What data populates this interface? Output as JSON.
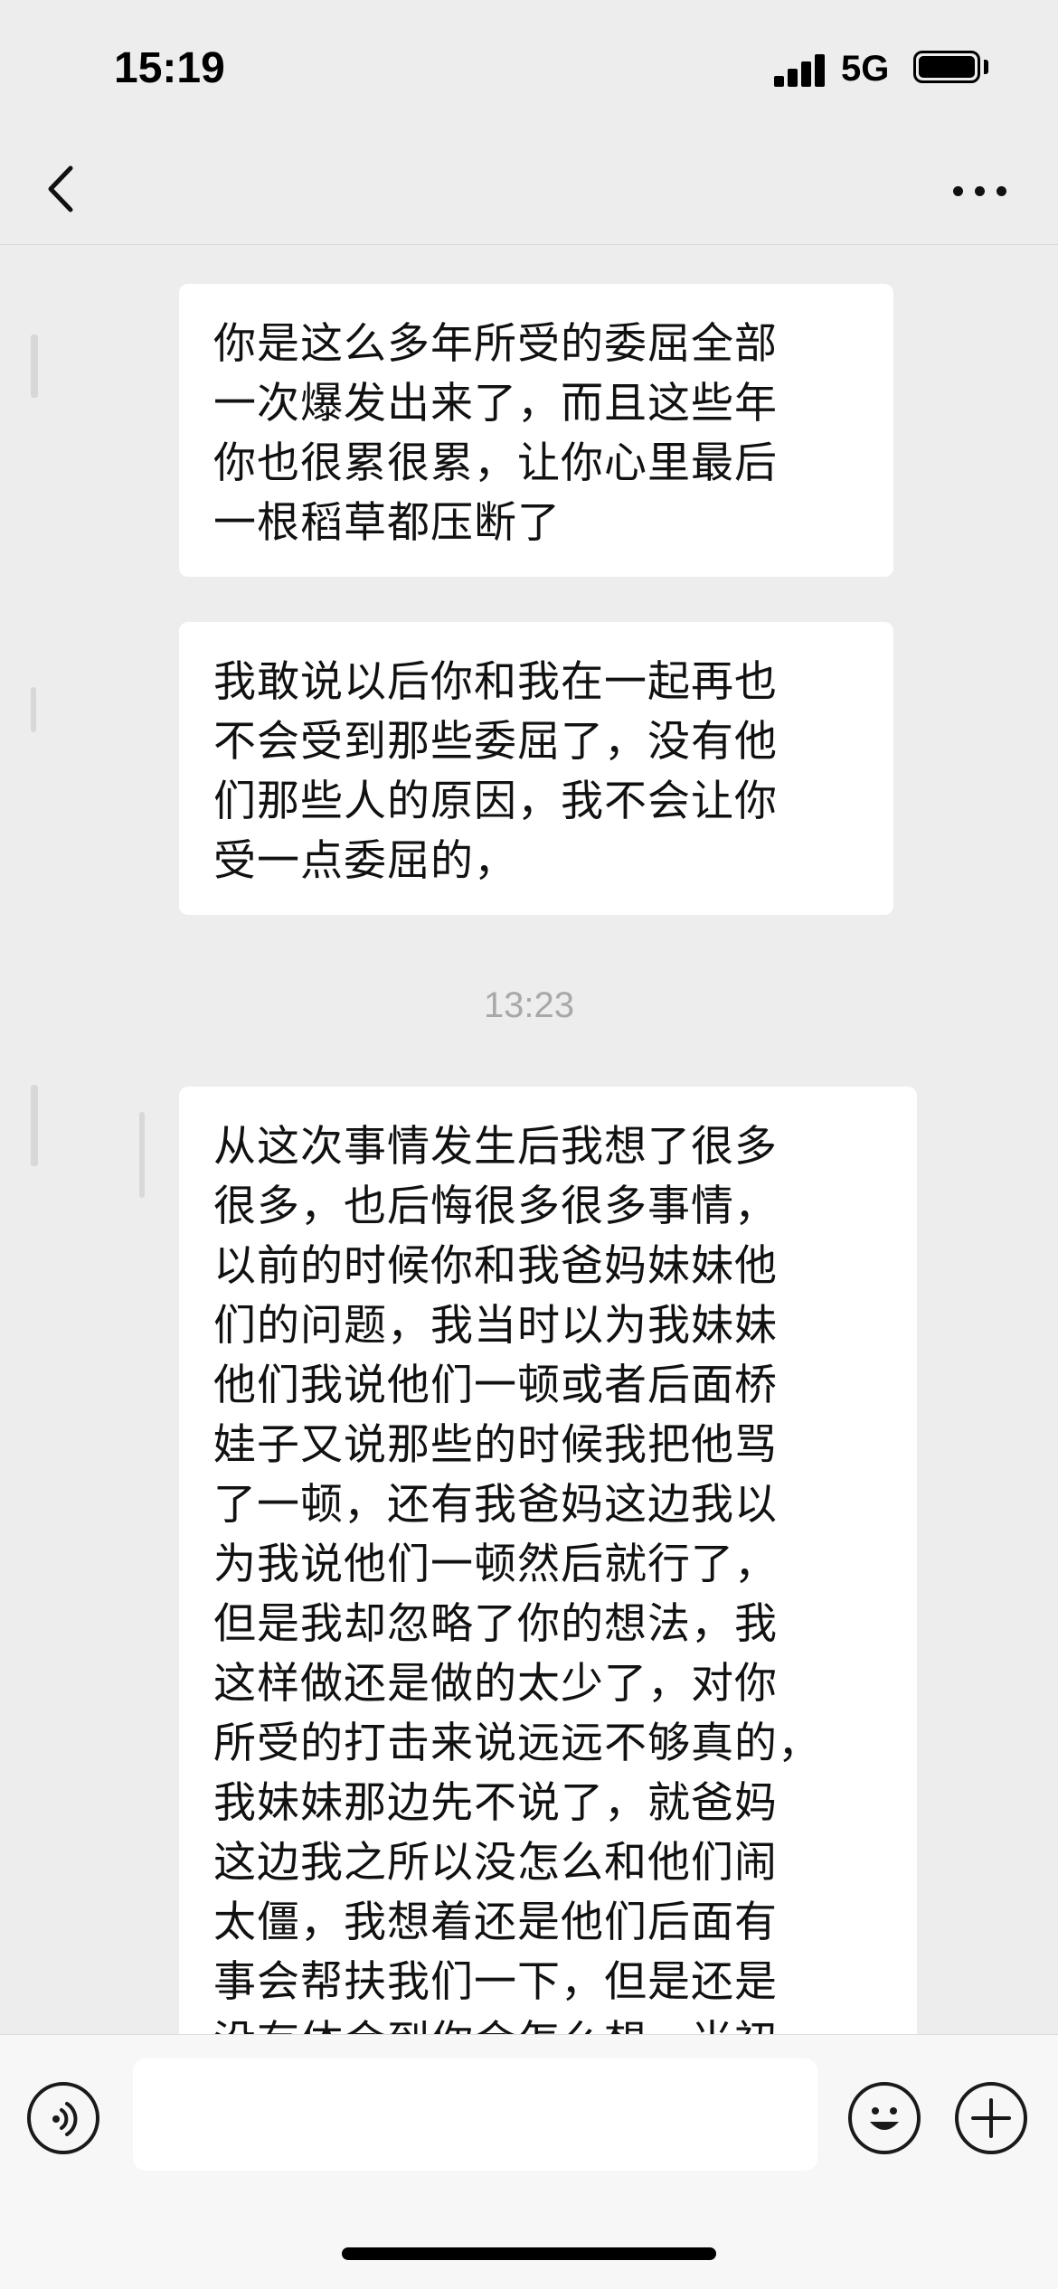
{
  "status_bar": {
    "time": "15:19",
    "network": "5G"
  },
  "nav": {
    "back_icon": "chevron-left-icon",
    "more_icon": "more-horizontal-icon"
  },
  "messages": [
    {
      "text": "你是这么多年所受的委屈全部\n一次爆发出来了，而且这些年\n你也很累很累，让你心里最后\n一根稻草都压断了"
    },
    {
      "text": "我敢说以后你和我在一起再也\n不会受到那些委屈了，没有他\n们那些人的原因，我不会让你\n受一点委屈的，"
    },
    {
      "text": "从这次事情发生后我想了很多\n很多，也后悔很多很多事情，\n以前的时候你和我爸妈妹妹他\n们的问题，我当时以为我妹妹\n他们我说他们一顿或者后面桥\n娃子又说那些的时候我把他骂\n了一顿，还有我爸妈这边我以\n为我说他们一顿然后就行了，\n但是我却忽略了你的想法，我\n这样做还是做的太少了，对你\n所受的打击来说远远不够真的，\n我妹妹那边先不说了，就爸妈\n这边我之所以没怎么和他们闹\n太僵，我想着还是他们后面有\n事会帮扶我们一下，但是还是\n没有体会到你会怎么想，当初"
    }
  ],
  "timestamp": "13:23",
  "input_bar": {
    "voice_icon": "voice-icon",
    "message_placeholder": "",
    "emoji_icon": "emoji-icon",
    "plus_icon": "plus-icon"
  }
}
